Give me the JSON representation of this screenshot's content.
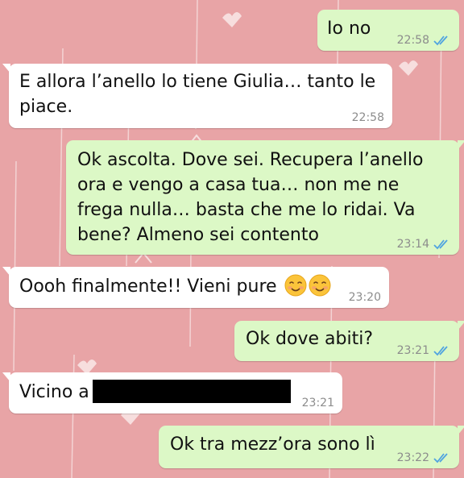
{
  "colors": {
    "wallpaper": "#e8a4a6",
    "outgoing_bubble": "#dcf8c6",
    "incoming_bubble": "#ffffff",
    "read_ticks": "#4fa3e0",
    "timestamp": "#8c8c8c"
  },
  "messages": [
    {
      "direction": "outgoing",
      "text": "Io no",
      "time": "22:58",
      "status_icon": "double-check-read-icon"
    },
    {
      "direction": "incoming",
      "text": "E allora l’anello lo tiene Giulia… tanto le piace.",
      "time": "22:58"
    },
    {
      "direction": "outgoing",
      "text": "Ok ascolta. Dove sei. Recupera l’anello ora e vengo a casa tua… non me ne frega nulla… basta che me lo ridai. Va bene? Almeno sei contento",
      "time": "23:14",
      "status_icon": "double-check-read-icon"
    },
    {
      "direction": "incoming",
      "text": "Oooh finalmente!! Vieni pure",
      "emoji": [
        "smiling-face-icon",
        "smiling-face-icon"
      ],
      "time": "23:20"
    },
    {
      "direction": "outgoing",
      "text": "Ok dove abiti?",
      "time": "23:21",
      "status_icon": "double-check-read-icon"
    },
    {
      "direction": "incoming",
      "text": "Vicino a",
      "redacted": true,
      "time": "23:21"
    },
    {
      "direction": "outgoing",
      "text": "Ok tra mezz’ora sono lì",
      "time": "23:22",
      "status_icon": "double-check-read-icon"
    }
  ]
}
